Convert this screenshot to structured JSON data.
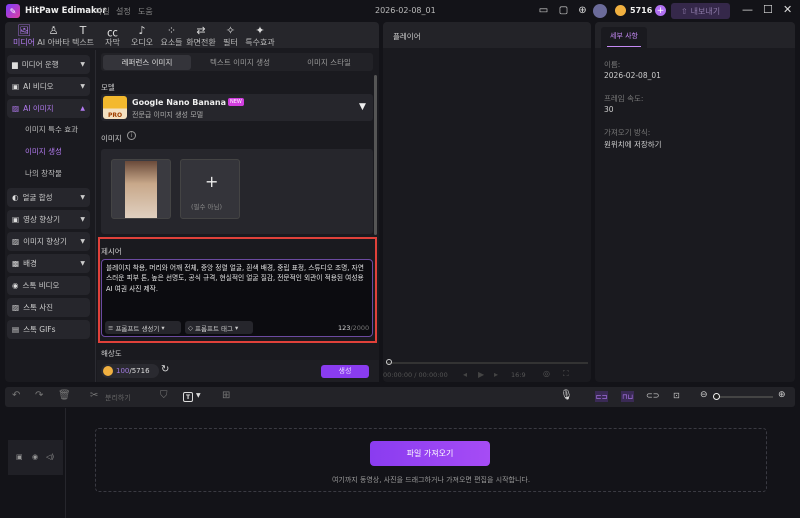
{
  "app": {
    "name": "HitPaw Edimakor",
    "menu": [
      "파일",
      "설정",
      "도움"
    ],
    "project": "2026-02-08_01",
    "credits": "5716",
    "export": "내보내기"
  },
  "nav": [
    {
      "label": "미디어",
      "icon": "media-icon"
    },
    {
      "label": "AI 아바타",
      "icon": "avatar-icon"
    },
    {
      "label": "텍스트",
      "icon": "text-icon"
    },
    {
      "label": "자막",
      "icon": "caption-icon"
    },
    {
      "label": "오디오",
      "icon": "audio-icon"
    },
    {
      "label": "요소들",
      "icon": "elements-icon"
    },
    {
      "label": "화면전환",
      "icon": "transition-icon"
    },
    {
      "label": "필터",
      "icon": "filter-icon"
    },
    {
      "label": "특수효과",
      "icon": "effects-icon"
    }
  ],
  "sidebar": {
    "items": [
      "미디어 운행",
      "AI 비디오",
      "AI 이미지",
      "얼굴 합성",
      "영상 향상기",
      "이미지 향상기",
      "배경",
      "스톡 비디오",
      "스톡 사진",
      "스톡 GIFs"
    ],
    "sub": [
      "이미지 특수 효과",
      "이미지 생성",
      "나의 창작물"
    ]
  },
  "main": {
    "tabs": [
      "레퍼런스 이미지",
      "텍스트 이미지 생성",
      "이미지 스타일"
    ],
    "model_label": "모델",
    "model_name": "Google Nano Banana Pro",
    "model_badge": "NEW",
    "model_desc": "전문급 이미지 생성 모델",
    "model_logo": "PRO",
    "image_label": "이미지",
    "optional": "(필수 아님)",
    "prompt_label": "제시어",
    "prompt": "블레이지 착용, 머리와 어깨 전체, 중앙 정렬 얼굴, 흰색 배경, 중립 표정, 스튜디오 조명, 자연스러운 피부 톤, 높은 선명도, 공식 규격, 현실적인 얼굴 질감, 전문적인 외관이 적용된 여성용 AI 여권 사진 제작.",
    "prompt_gen": "프롬프트 생성기",
    "prompt_tag": "프롬프트 태그",
    "count": "123",
    "max": "/2000",
    "resolution_label": "해상도",
    "cost": "100",
    "balance": "/5716",
    "generate": "생성"
  },
  "player": {
    "title": "플레이어",
    "time": "00:00:00 / 00:00:00",
    "ratio": "16:9"
  },
  "details": {
    "tab": "세부 사항",
    "name_label": "이름:",
    "name": "2026-02-08_01",
    "fps_label": "프레임 속도:",
    "fps": "30",
    "import_label": "가져오기 방식:",
    "import": "원위치에 저장하기"
  },
  "timeline": {
    "split": "분리하기",
    "import_btn": "파일 가져오기",
    "hint": "여기까지 동영상, 사진을 드래그하거나 가져오면 편집을 시작합니다."
  },
  "colors": {
    "accent": "#9b4dff",
    "highlight": "#e0413a"
  }
}
